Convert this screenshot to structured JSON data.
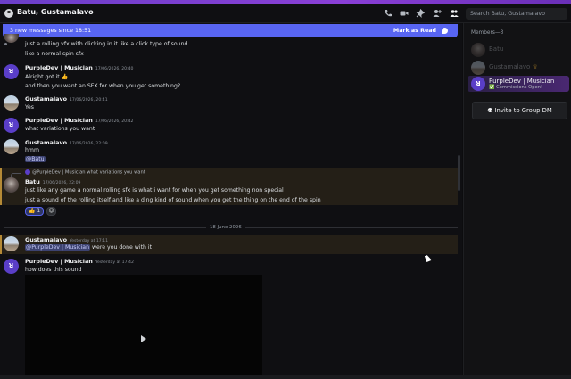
{
  "window": {
    "title": "Batu, Gustamalavo"
  },
  "header": {
    "search_placeholder": "Search Batu, Gustamalavo",
    "icons": [
      "phone-icon",
      "video-icon",
      "pin-icon",
      "add-member-icon",
      "members-icon"
    ]
  },
  "banner": {
    "text": "3 new messages since 18:51",
    "mark_label": "Mark as Read"
  },
  "messages": [
    {
      "text1": "just a rolling vfx with clicking in it like a click type of sound",
      "text2": "like a normal spin sfx"
    },
    {
      "author": "PurpleDev | Musician",
      "time": "17/06/2026, 20:40",
      "text1": "Alright got it 👍",
      "text2": "and then you want an SFX for when you get something?"
    },
    {
      "author": "Gustamalavo",
      "time": "17/06/2026, 20:41",
      "text1": "Yes"
    },
    {
      "author": "PurpleDev | Musician",
      "time": "17/06/2026, 20:42",
      "text1": "what variations you want"
    },
    {
      "author": "Gustamalavo",
      "time": "17/06/2026, 22:09",
      "text1": "hmm",
      "mention": "@Batu"
    },
    {
      "reply_to": "@PurpleDev | Musician",
      "reply_text": "what variations you want",
      "author": "Batu",
      "time": "17/06/2026, 22:09",
      "text1": "just like any game a normal rolling sfx is what i want for when you get something non special",
      "text2": "just a sound of the rolling itself and like a ding kind of sound when you get the thing on the end of the spin",
      "reaction_emoji": "👍",
      "reaction_count": "1"
    },
    {
      "author": "Gustamalavo",
      "time": "Yesterday at 17:11",
      "mention": "@PurpleDev | Musician",
      "text1": " were  you done with it"
    },
    {
      "author": "PurpleDev | Musician",
      "time": "Yesterday at 17:42",
      "text1": "how does this sound"
    }
  ],
  "divider": "18 June 2026",
  "members": {
    "header": "Members—3",
    "list": [
      {
        "name": "Batu",
        "status": ""
      },
      {
        "name": "Gustamalavo",
        "status": ""
      },
      {
        "name": "PurpleDev | Musician",
        "status": "Commissions Open!"
      }
    ],
    "invite_label": "Invite to Group DM"
  },
  "colors": {
    "accent": "#5865f2",
    "mention_highlight": "#241f17",
    "member_gradient": "#5b2f86"
  }
}
